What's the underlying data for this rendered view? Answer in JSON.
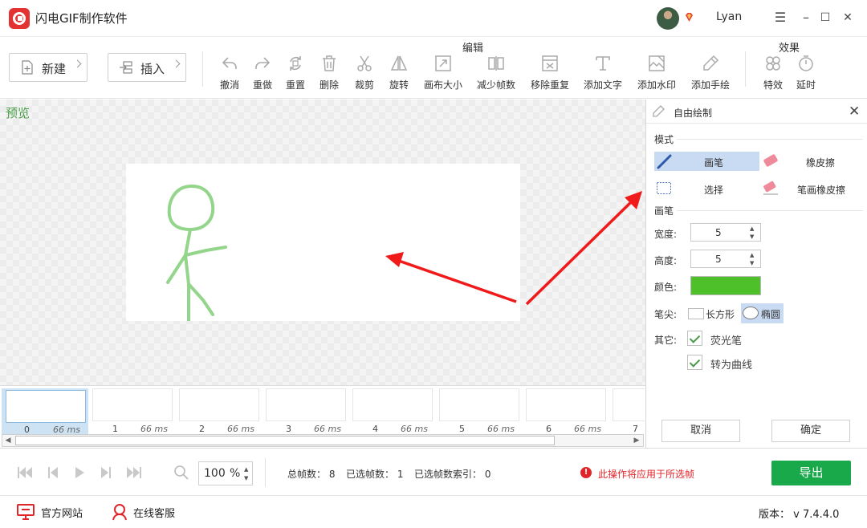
{
  "app": {
    "title": "闪电GIF制作软件",
    "username": "Lyan"
  },
  "window": {
    "minimize": "☰",
    "restore": "–",
    "maximize": "☐",
    "close": "✕"
  },
  "toolbar": {
    "new_label": "新建",
    "insert_label": "插入",
    "edit_group": "编辑",
    "effects_group": "效果",
    "tools": [
      {
        "label": "撤消",
        "icon": "undo-icon"
      },
      {
        "label": "重做",
        "icon": "redo-icon"
      },
      {
        "label": "重置",
        "icon": "reset-icon"
      },
      {
        "label": "删除",
        "icon": "trash-icon"
      },
      {
        "label": "裁剪",
        "icon": "scissors-icon"
      },
      {
        "label": "旋转",
        "icon": "rotate-icon"
      },
      {
        "label": "画布大小",
        "icon": "canvas-size-icon"
      },
      {
        "label": "减少帧数",
        "icon": "reduce-frames-icon"
      },
      {
        "label": "移除重复",
        "icon": "remove-duplicates-icon"
      },
      {
        "label": "添加文字",
        "icon": "add-text-icon"
      },
      {
        "label": "添加水印",
        "icon": "add-watermark-icon"
      },
      {
        "label": "添加手绘",
        "icon": "add-drawing-icon"
      },
      {
        "label": "特效",
        "icon": "effects-icon"
      },
      {
        "label": "延时",
        "icon": "delay-icon"
      }
    ]
  },
  "preview": {
    "label": "预览"
  },
  "filmstrip": {
    "frames": [
      {
        "index": "0",
        "duration": "66 ms"
      },
      {
        "index": "1",
        "duration": "66 ms"
      },
      {
        "index": "2",
        "duration": "66 ms"
      },
      {
        "index": "3",
        "duration": "66 ms"
      },
      {
        "index": "4",
        "duration": "66 ms"
      },
      {
        "index": "5",
        "duration": "66 ms"
      },
      {
        "index": "6",
        "duration": "66 ms"
      },
      {
        "index": "7",
        "duration": ""
      }
    ],
    "selected_index": 0
  },
  "panel": {
    "title": "自由绘制",
    "mode_label": "模式",
    "modes": {
      "pen": "画笔",
      "eraser": "橡皮擦",
      "select": "选择",
      "stroke_eraser": "笔画橡皮擦"
    },
    "brush_label": "画笔",
    "width_label": "宽度:",
    "width_value": "5",
    "height_label": "高度:",
    "height_value": "5",
    "color_label": "颜色:",
    "color_value": "#4ec12a",
    "tip_label": "笔尖:",
    "tip_rect": "长方形",
    "tip_ellipse": "椭圆",
    "other_label": "其它:",
    "highlighter": "荧光笔",
    "to_curve": "转为曲线",
    "cancel": "取消",
    "confirm": "确定"
  },
  "controls": {
    "zoom_value": "100",
    "zoom_unit": "%",
    "total_frames": "总帧数： 8",
    "selected_frames": "已选帧数： 1",
    "selected_index": "已选帧数索引： 0",
    "warning": "此操作将应用于所选帧",
    "export": "导出"
  },
  "footer": {
    "website": "官方网站",
    "support": "在线客服",
    "version": "版本： v 7.4.4.0"
  },
  "colors": {
    "accent_green": "#1aa94a",
    "warning_red": "#e0262a",
    "pen_color": "#4ec12a"
  }
}
